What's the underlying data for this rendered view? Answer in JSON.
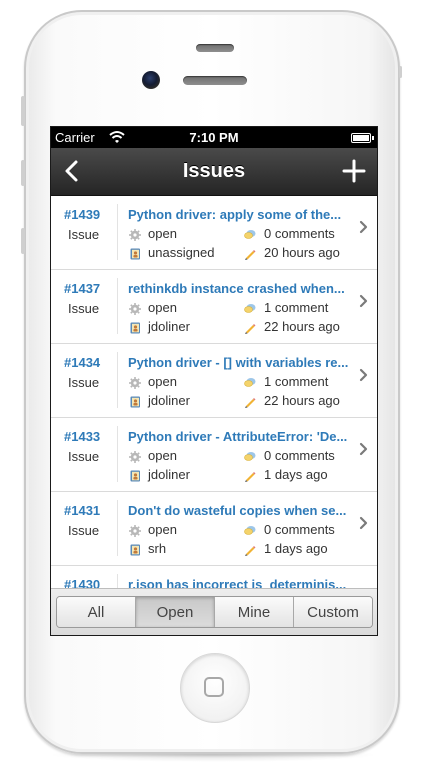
{
  "status_bar": {
    "carrier": "Carrier",
    "time": "7:10 PM"
  },
  "nav": {
    "title": "Issues",
    "back_icon": "chevron-left-icon",
    "add_icon": "plus-icon"
  },
  "issues": [
    {
      "number": "#1439",
      "type": "Issue",
      "title": "Python driver: apply some of the...",
      "state": "open",
      "comments": "0 comments",
      "assignee": "unassigned",
      "updated": "20 hours ago"
    },
    {
      "number": "#1437",
      "type": "Issue",
      "title": "rethinkdb instance crashed when...",
      "state": "open",
      "comments": "1 comment",
      "assignee": "jdoliner",
      "updated": "22 hours ago"
    },
    {
      "number": "#1434",
      "type": "Issue",
      "title": "Python driver - [] with variables re...",
      "state": "open",
      "comments": "1 comment",
      "assignee": "jdoliner",
      "updated": "22 hours ago"
    },
    {
      "number": "#1433",
      "type": "Issue",
      "title": "Python driver - AttributeError: 'De...",
      "state": "open",
      "comments": "0 comments",
      "assignee": "jdoliner",
      "updated": "1 days ago"
    },
    {
      "number": "#1431",
      "type": "Issue",
      "title": "Don't do wasteful copies when se...",
      "state": "open",
      "comments": "0 comments",
      "assignee": "srh",
      "updated": "1 days ago"
    },
    {
      "number": "#1430",
      "type": "",
      "title": "r.json has incorrect is_determinis...",
      "state": "",
      "comments": "",
      "assignee": "",
      "updated": ""
    }
  ],
  "filters": {
    "tabs": [
      {
        "label": "All",
        "active": false
      },
      {
        "label": "Open",
        "active": true
      },
      {
        "label": "Mine",
        "active": false
      },
      {
        "label": "Custom",
        "active": false
      }
    ]
  },
  "colors": {
    "link": "#2e7ab8",
    "navbar": "#2b2b2b"
  }
}
